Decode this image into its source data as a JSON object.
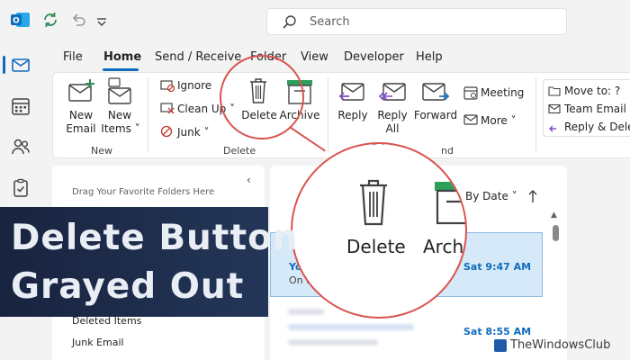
{
  "search": {
    "placeholder": "Search"
  },
  "menu_tabs": [
    "File",
    "Home",
    "Send / Receive",
    "Folder",
    "View",
    "Developer",
    "Help"
  ],
  "ribbon": {
    "new_group": {
      "new_email": [
        "New",
        "Email"
      ],
      "new_items": [
        "New",
        "Items ˅"
      ],
      "label": "New"
    },
    "delete_group": {
      "ignore": "Ignore",
      "clean_up": "Clean Up ˅",
      "junk": "Junk ˅",
      "delete": "Delete",
      "archive": "Archive",
      "label": "Delete"
    },
    "respond_group": {
      "reply": "Reply",
      "reply_all": [
        "Reply",
        "All"
      ],
      "forward": "Forward",
      "meeting": "Meeting",
      "more": "More ˅",
      "label_partial": "nd"
    },
    "quick_steps": {
      "move_to": "Move to: ?",
      "team_email": "Team Email",
      "reply_delete": "Reply & Delet"
    }
  },
  "folder_pane": {
    "drag_hint": "Drag Your Favorite Folders Here",
    "folders": [
      "Deleted Items",
      "Junk Email"
    ]
  },
  "message_list": {
    "sort": "By Date ˅",
    "messages": [
      {
        "sender": "Yo",
        "preview": "On t",
        "time": "Sat 9:47 AM"
      },
      {
        "time": "Sat 8:55 AM"
      }
    ]
  },
  "magnifier": {
    "delete": "Delete",
    "archive": "Arch",
    "folder_partial": "Folde"
  },
  "banner": {
    "line1": "Delete Button",
    "line2": "Grayed Out"
  },
  "watermark": "TheWindowsClub",
  "colors": {
    "accent": "#0f6cbd",
    "highlight": "#d9534f",
    "banner": "#1e2d4d"
  }
}
